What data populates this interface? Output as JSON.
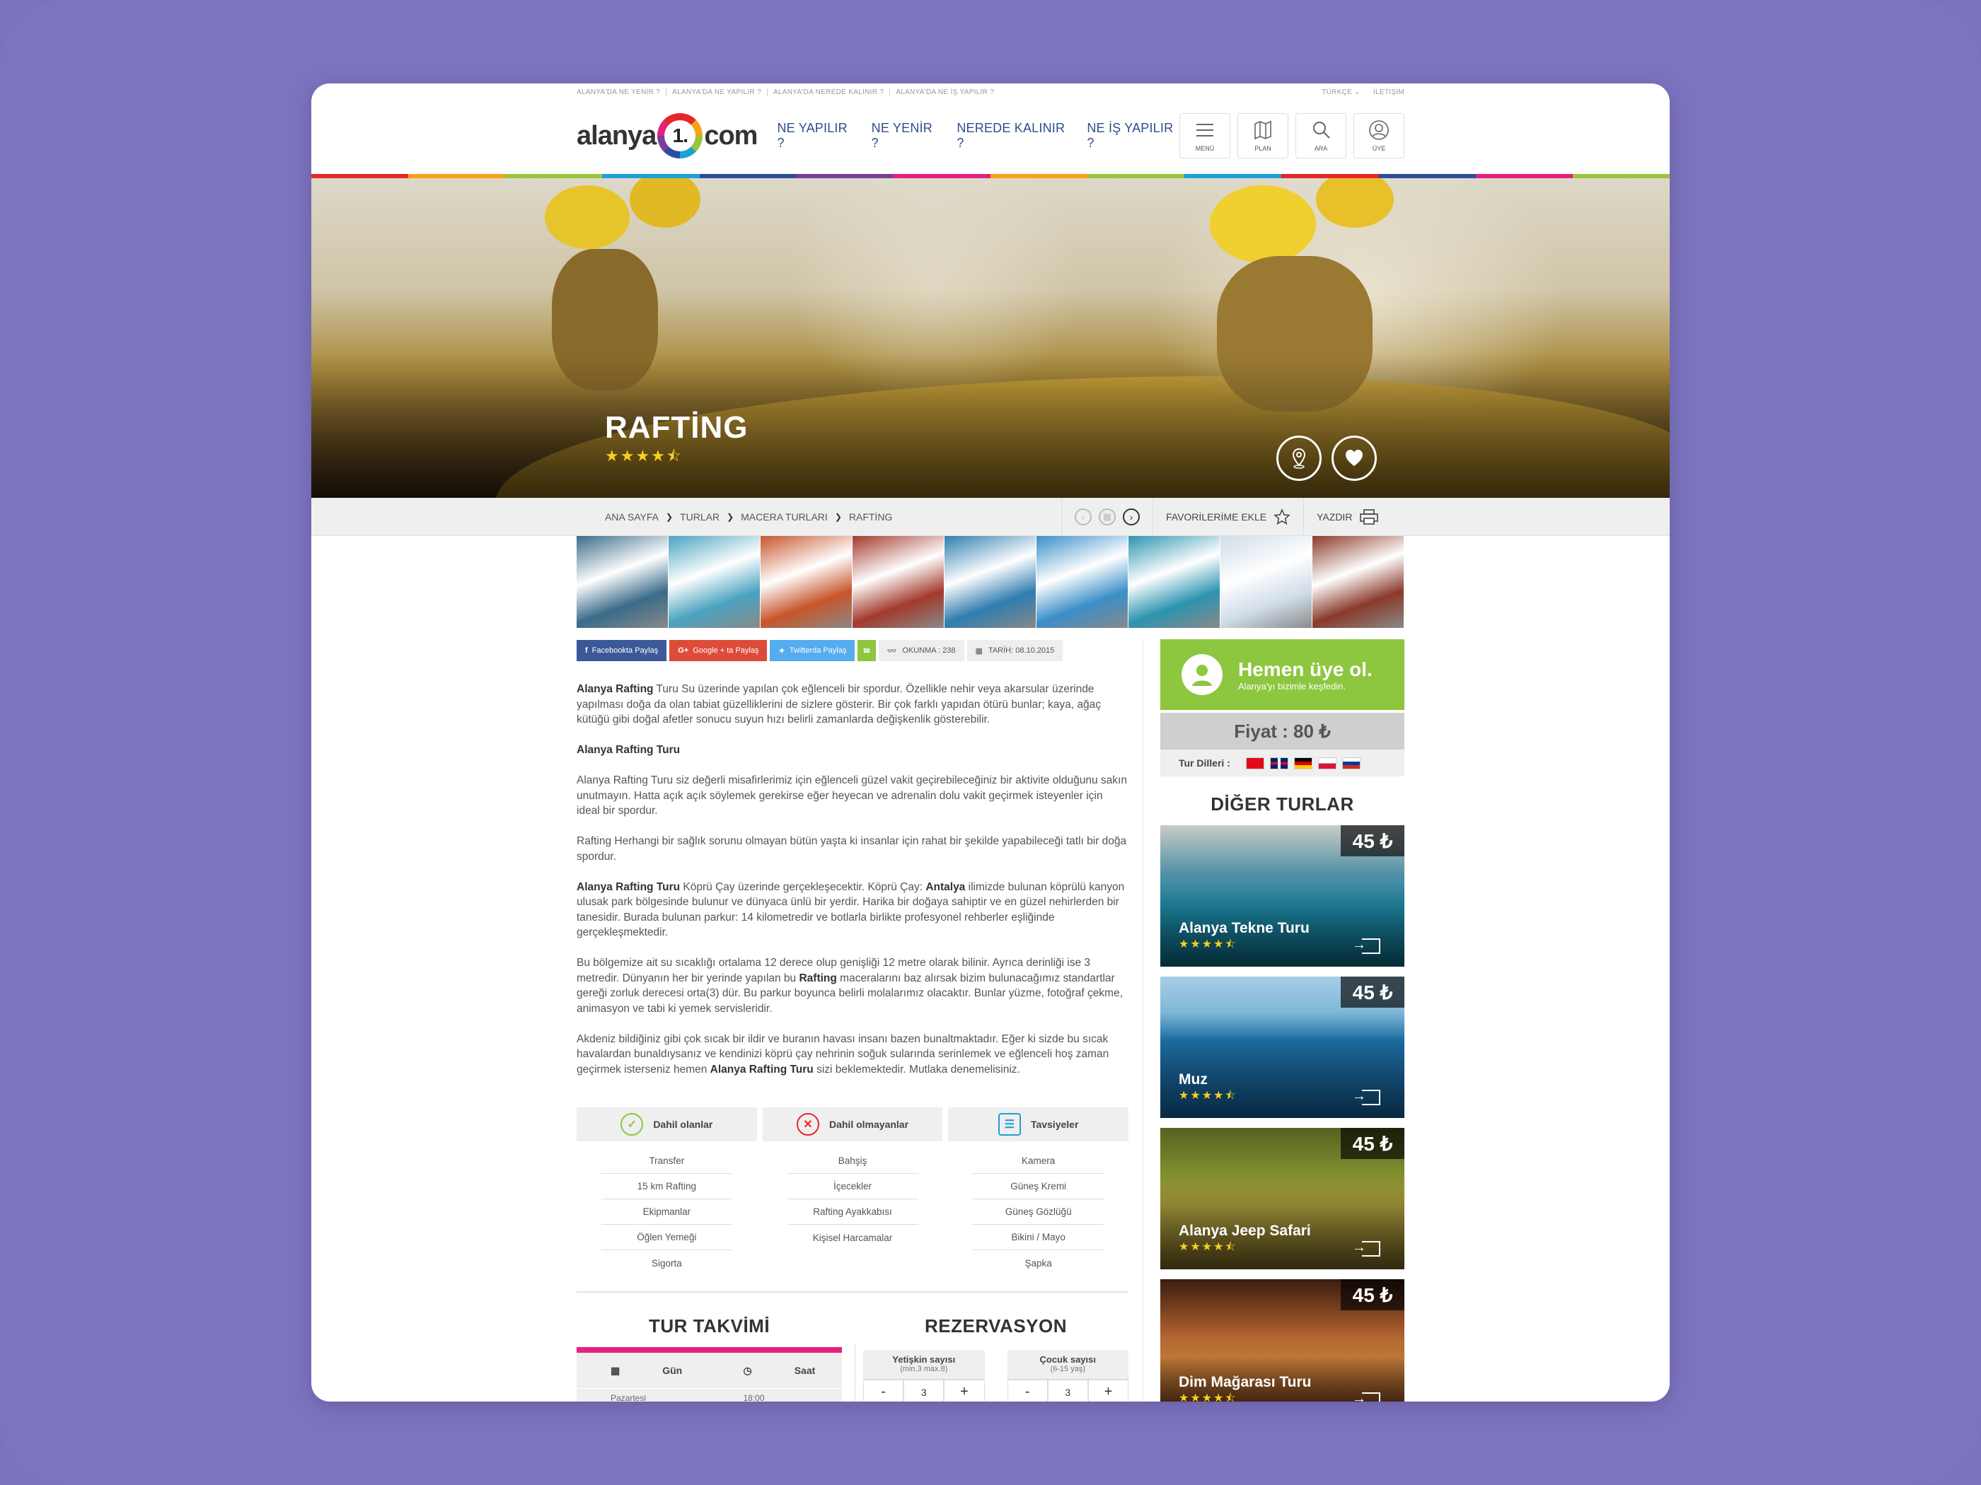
{
  "top_links": [
    "ALANYA'DA NE YENİR ?",
    "ALANYA'DA NE YAPILIR ?",
    "ALANYA'DA NEREDE KALINIR ?",
    "ALANYA'DA NE İŞ YAPILIR ?"
  ],
  "top_right": {
    "language": "TÜRKÇE ⌄",
    "contact": "İLETİŞİM"
  },
  "logo": {
    "left": "alanya",
    "mid": "1.",
    "right": "com"
  },
  "nav": [
    "NE YAPILIR ?",
    "NE YENİR ?",
    "NEREDE KALINIR ?",
    "NE İŞ YAPILIR ?"
  ],
  "header_buttons": [
    {
      "label": "MENÜ",
      "icon": "menu-icon"
    },
    {
      "label": "PLAN",
      "icon": "map-icon"
    },
    {
      "label": "ARA",
      "icon": "search-icon"
    },
    {
      "label": "ÜYE",
      "icon": "user-icon"
    }
  ],
  "stripe_colors": [
    "#e7262a",
    "#f6a21b",
    "#9bc43c",
    "#1e9fd8",
    "#2d4d9e",
    "#7a3f98",
    "#e3227e",
    "#f6a21b",
    "#9bc43c",
    "#1e9fd8",
    "#e7262a",
    "#2d4d9e",
    "#e3227e",
    "#9bc43c"
  ],
  "hero": {
    "title": "RAFTİNG",
    "stars": "★★★★⯪",
    "rating": 4.5
  },
  "breadcrumb": [
    "ANA SAYFA",
    "TURLAR",
    "MACERA TURLARI",
    "RAFTİNG"
  ],
  "tools": {
    "favorite": "FAVORİLERİME EKLE",
    "print": "YAZDIR"
  },
  "gallery_colors": [
    "#3a6b8a",
    "#4aa3c0",
    "#c8552a",
    "#a33a2c",
    "#2f7db0",
    "#3a8fc8",
    "#2c94b0",
    "#cfdce8",
    "#8a3a2a"
  ],
  "share": {
    "facebook": "Facebookta Paylaş",
    "google": "Google + ta Paylaş",
    "twitter": "Twitterda Paylaş",
    "views": "OKUNMA : 238",
    "date": "TARİH: 08.10.2015"
  },
  "article": {
    "p1_b": "Alanya Rafting",
    "p1": " Turu Su üzerinde yapılan çok eğlenceli bir spordur. Özellikle nehir veya akarsular üzerinde yapılması doğa da olan tabiat güzelliklerini de sizlere gösterir. Bir çok farklı yapıdan ötürü bunlar; kaya, ağaç kütüğü gibi doğal afetler sonucu suyun hızı belirli zamanlarda değişkenlik gösterebilir.",
    "h2": "Alanya Rafting Turu",
    "p2": "Alanya Rafting Turu siz değerli misafirlerimiz için eğlenceli güzel vakit geçirebileceğiniz bir aktivite olduğunu sakın unutmayın. Hatta açık açık söylemek gerekirse eğer heyecan ve adrenalin dolu vakit geçirmek isteyenler için ideal bir spordur.",
    "p3": "Rafting Herhangi bir sağlık sorunu olmayan bütün yaşta ki insanlar için rahat bir şekilde yapabileceği tatlı bir doğa spordur.",
    "p4_b": "Alanya Rafting Turu",
    "p4_a": " Köprü Çay üzerinde gerçekleşecektir. Köprü Çay: ",
    "p4_b2": "Antalya",
    "p4_c": " ilimizde bulunan köprülü kanyon ulusak park bölgesinde bulunur ve dünyaca ünlü bir yerdir. Harika bir doğaya sahiptir ve en güzel nehirlerden bir tanesidir. Burada bulunan parkur: 14 kilometredir ve botlarla birlikte profesyonel rehberler eşliğinde gerçekleşmektedir.",
    "p5_a": "Bu bölgemize ait su sıcaklığı ortalama 12 derece olup genişliği 12 metre olarak bilinir. Ayrıca derinliği ise 3 metredir. Dünyanın her bir yerinde yapılan bu ",
    "p5_b": "Rafting",
    "p5_c": " maceralarını baz alırsak bizim bulunacağımız standartlar gereği zorluk derecesi orta(3) dür. Bu parkur boyunca belirli molalarımız olacaktır. Bunlar yüzme, fotoğraf çekme, animasyon ve tabi ki yemek servisleridir.",
    "p6_a": "Akdeniz bildiğiniz gibi çok sıcak bir ildir ve buranın havası insanı bazen bunaltmaktadır. Eğer ki sizde bu sıcak havalardan bunaldıysanız ve kendinizi köprü çay nehrinin soğuk sularında serinlemek ve eğlenceli hoş zaman geçirmek isterseniz hemen ",
    "p6_b": "Alanya Rafting Turu",
    "p6_c": " sizi beklemektedir. Mutlaka denemelisiniz."
  },
  "features": {
    "included": {
      "title": "Dahil olanlar",
      "items": [
        "Transfer",
        "15 km Rafting",
        "Ekipmanlar",
        "Öğlen Yemeği",
        "Sigorta"
      ]
    },
    "excluded": {
      "title": "Dahil olmayanlar",
      "items": [
        "Bahşiş",
        "İçecekler",
        "Rafting Ayakkabısı",
        "Kişisel Harcamalar"
      ]
    },
    "advice": {
      "title": "Tavsiyeler",
      "items": [
        "Kamera",
        "Güneş Kremi",
        "Güneş Gözlüğü",
        "Bikini / Mayo",
        "Şapka"
      ]
    }
  },
  "schedule": {
    "title": "TUR TAKVİMİ",
    "day": "Gün",
    "time": "Saat",
    "rows": [
      {
        "day": "Pazartesi",
        "time": "18:00"
      }
    ]
  },
  "reservation": {
    "title": "REZERVASYON",
    "adult": {
      "label": "Yetişkin sayısı",
      "sub": "(min.3 max.8)",
      "value": "3"
    },
    "child": {
      "label": "Çocuk sayısı",
      "sub": "(6-15 yaş)",
      "value": "3"
    },
    "minus": "-",
    "plus": "+"
  },
  "join": {
    "title": "Hemen üye ol.",
    "subtitle": "Alanya'yı bizimle keşfedin."
  },
  "price": "Fiyat : 80 ₺",
  "languages": {
    "label": "Tur Dilleri :",
    "flags": [
      "tr",
      "uk",
      "de",
      "pl",
      "ru"
    ]
  },
  "other_title": "DİĞER TURLAR",
  "tours": [
    {
      "name": "Alanya Tekne Turu",
      "price": "45 ₺",
      "stars": "★★★★⯪",
      "rating": 4.5,
      "bg": "linear-gradient(180deg,#c9ccc4 0%,#4f8fa7 35%,#1d8aa6 60%,#0b5f78 100%)"
    },
    {
      "name": "Muz",
      "price": "45 ₺",
      "stars": "★★★★⯪",
      "rating": 4.5,
      "bg": "linear-gradient(180deg,#a6cde6 0%,#7fb8d8 25%,#1f6fa6 45%,#12598f 100%)"
    },
    {
      "name": "Alanya Jeep Safari",
      "price": "45 ₺",
      "stars": "★★★★⯪",
      "rating": 4.5,
      "bg": "linear-gradient(180deg,#56621f 0%,#7b8c2d 30%,#a7993c 55%,#6a5a20 100%)"
    },
    {
      "name": "Dim Mağarası Turu",
      "price": "45 ₺",
      "stars": "★★★★⯪",
      "rating": 4.5,
      "bg": "linear-gradient(180deg,#3a1e10 0%,#a3582a 35%,#d9893e 55%,#4a2412 100%)"
    }
  ]
}
